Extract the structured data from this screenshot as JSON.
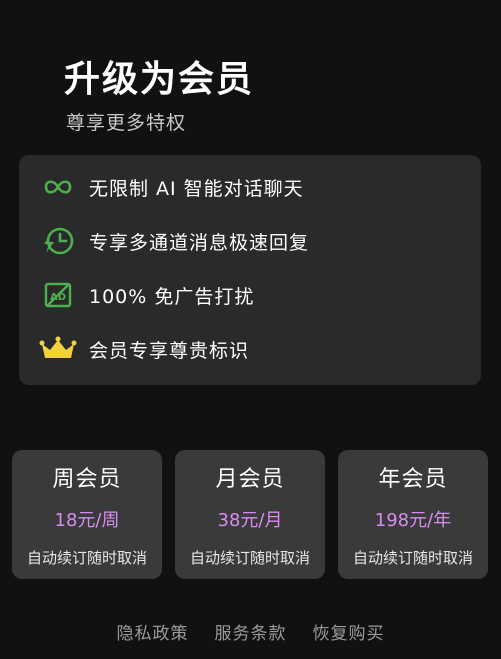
{
  "header": {
    "title": "升级为会员",
    "subtitle": "尊享更多特权"
  },
  "features": [
    {
      "icon": "infinity-icon",
      "label": "无限制 AI 智能对话聊天",
      "color": "#4caf50"
    },
    {
      "icon": "fast-clock-icon",
      "label": "专享多通道消息极速回复",
      "color": "#4caf50"
    },
    {
      "icon": "no-ads-icon",
      "label": "100% 免广告打扰",
      "color": "#4caf50"
    },
    {
      "icon": "crown-icon",
      "label": "会员专享尊贵标识",
      "color": "#f2d33c"
    }
  ],
  "plans": [
    {
      "name": "周会员",
      "price": "18元/周",
      "note": "自动续订随时取消"
    },
    {
      "name": "月会员",
      "price": "38元/月",
      "note": "自动续订随时取消"
    },
    {
      "name": "年会员",
      "price": "198元/年",
      "note": "自动续订随时取消"
    }
  ],
  "footer": {
    "privacy": "隐私政策",
    "terms": "服务条款",
    "restore": "恢复购买"
  },
  "colors": {
    "background": "#111111",
    "card": "#2a2a2a",
    "plan_card": "#3a3a3a",
    "price": "#d98cf0",
    "accent_green": "#4caf50",
    "crown": "#f2d33c"
  }
}
